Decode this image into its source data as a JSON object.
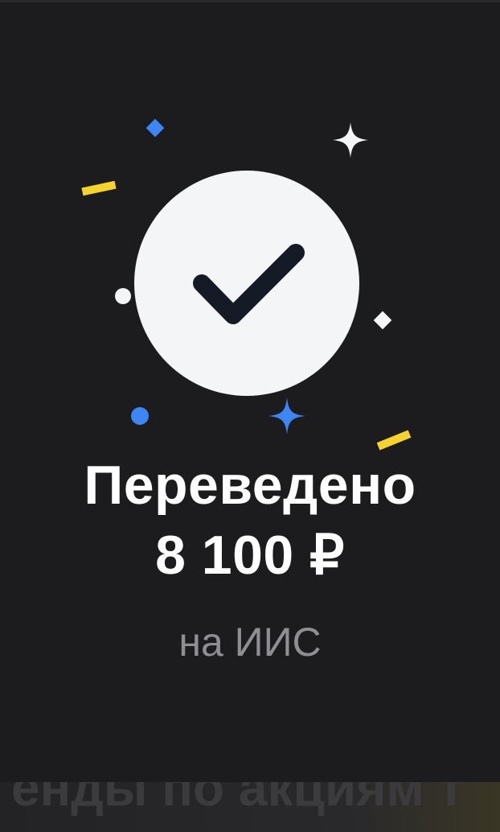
{
  "status": {
    "title_line1": "Переведено",
    "amount": "8 100 ₽",
    "destination": "на ИИС"
  },
  "background_content": {
    "partial_text": "енды по акциям т"
  },
  "icons": {
    "success": "checkmark-circle-icon"
  },
  "colors": {
    "background": "#1c1c1e",
    "circle": "#f4f5f7",
    "checkmark": "#141a26",
    "blue_accent": "#3d86f4",
    "yellow_accent": "#f5d230",
    "white_accent": "#f4f5f7",
    "subtitle": "#8e8e93"
  }
}
